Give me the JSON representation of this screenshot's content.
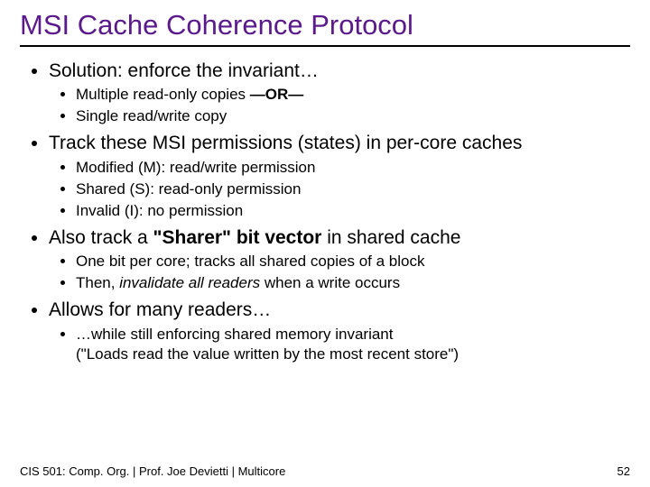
{
  "title": "MSI Cache Coherence Protocol",
  "l1": [
    "Solution: enforce the invariant…",
    "Track these MSI permissions (states) in per-core caches",
    "",
    "Allows for many readers…"
  ],
  "l1_also_pre": "Also track a ",
  "l1_also_bold": "\"Sharer\" bit vector",
  "l1_also_post": " in shared cache",
  "sub1": {
    "a": "Multiple read-only copies",
    "or": "  —OR—",
    "b": "Single read/write copy"
  },
  "sub2": {
    "a": "Modified (M): read/write permission",
    "b": "Shared (S): read-only permission",
    "c": "Invalid (I): no permission"
  },
  "sub3": {
    "a": "One bit per core; tracks all shared copies of a block",
    "b_pre": "Then, ",
    "b_it": "invalidate all readers",
    "b_post": " when a write occurs"
  },
  "sub4": {
    "a": "…while still enforcing shared memory invariant",
    "b": "(\"Loads read the value written by the most recent store\")"
  },
  "footer": "CIS 501: Comp. Org. | Prof. Joe Devietti  |  Multicore",
  "page": "52"
}
